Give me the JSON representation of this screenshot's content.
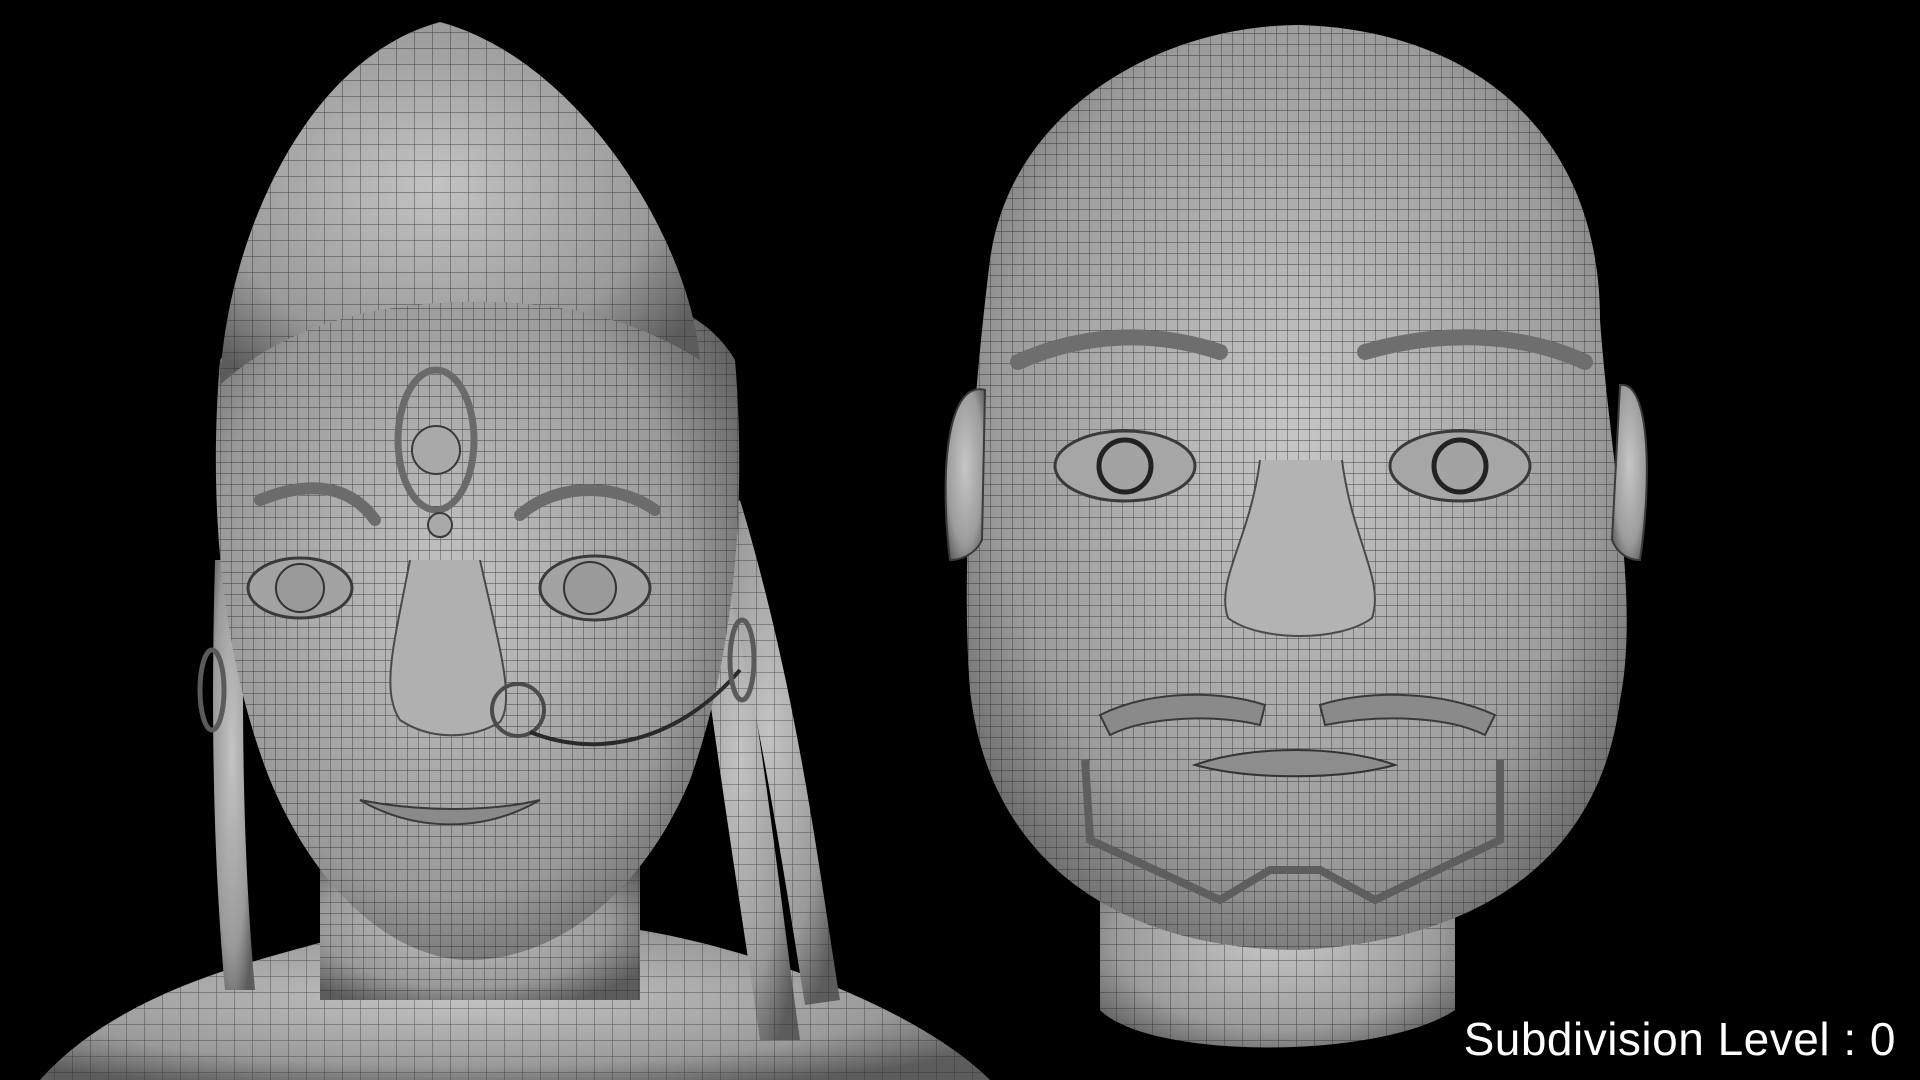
{
  "caption": {
    "text": "Subdivision Level : 0"
  },
  "colors": {
    "background": "#000000",
    "mesh_fill": "#9c9c9c",
    "mesh_shadow": "#5a5a5a",
    "wire": "#2c2c2c",
    "caption": "#ffffff"
  },
  "models": [
    {
      "name": "female-head-with-cap-wireframe"
    },
    {
      "name": "male-bald-head-wireframe"
    }
  ]
}
